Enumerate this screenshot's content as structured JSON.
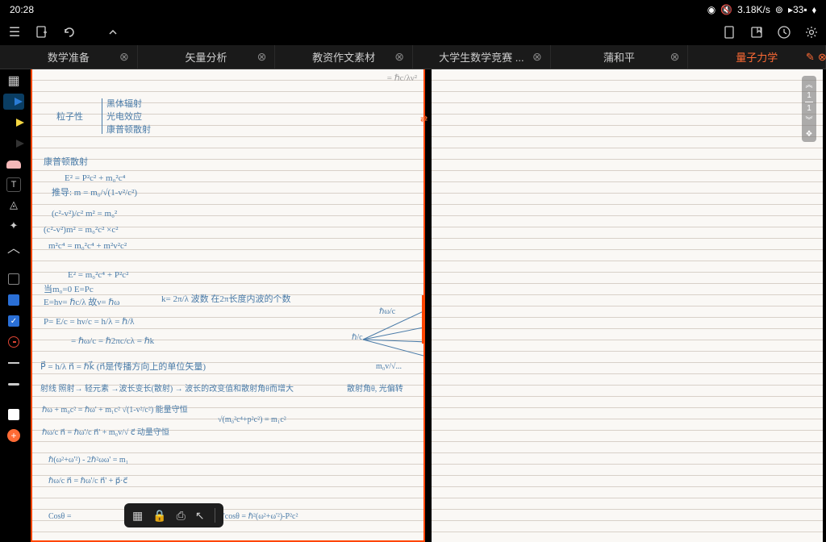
{
  "status": {
    "time": "20:28",
    "speed": "3.18K/s",
    "battery": "33"
  },
  "tabs": [
    {
      "label": "数学准备",
      "active": false
    },
    {
      "label": "矢量分析",
      "active": false
    },
    {
      "label": "教资作文素材",
      "active": false
    },
    {
      "label": "大学生数学竞赛 ...",
      "active": false
    },
    {
      "label": "蒲和平",
      "active": false
    },
    {
      "label": "量子力学",
      "active": true
    }
  ],
  "scroll": {
    "current": "1",
    "total": "1"
  },
  "notes": {
    "topRight": "= ℏc/λν²",
    "section1_title": "粒子性",
    "section1_items": [
      "黑体辐射",
      "光电效应",
      "康普顿散射"
    ],
    "section2_title": "康普顿散射",
    "eq1": "E² = P²c² + m₀²c⁴",
    "eq2": "推导: m = m₀/√(1-v²/c²)",
    "eq3": "(c²-v²)/c² m² = m₀²",
    "eq4": "(c²-v²)m² = m₀²c²     ×c²",
    "eq5": "m²c⁴ = m₀²c⁴ + m²v²c²",
    "eq6": "E² = m₀²c⁴ + P²c²",
    "eq7": "当m₀=0     E=Pc",
    "eq8": "E=hν= ℏc/λ  故ν= ℏω",
    "eq8b": "k= 2π/λ  波数  在2π长度内波的个数",
    "eq9a": "P= E/c = hν/c = h/λ = ℏ/ƛ",
    "eq9b": "    = ℏω/c = ℏ2πc/cλ = ℏk",
    "eq10": "P⃗ = h/λ n⃗ = ℏk⃗  (n⃗是传播方向上的单位矢量)",
    "eq11": "射线 照射→ 轻元素 →波长变长(散射) → 波长的改变值和散射角θ而增大",
    "eq11b": "散射角θ, 光偏转",
    "eq12": "ℏω + m₀c² = ℏω' + m₁c²  √(1-v²/c²)  能量守恒",
    "eq13": "ℏω/c n⃗ = ℏω'/c n⃗' + m₀v/√  c⃗   动量守恒",
    "eq13b": "√(m₀²c⁴+p²c²) = m₁c²",
    "eq14": "ℏ(ω²+ω'²) - 2ℏ²ωω' = m₁",
    "eq15": "ℏω/c n⃗ = ℏω'/c n⃗' + p⃗·c⃗",
    "eq16": "Cosθ =",
    "eq16b": "→ 2ℏωω'cosθ = ℏ²(ω²+ω'²)-P²c²",
    "diag1": "ℏω/c",
    "diag2": "ℏ/c",
    "diag3": "m₀v/√..."
  }
}
